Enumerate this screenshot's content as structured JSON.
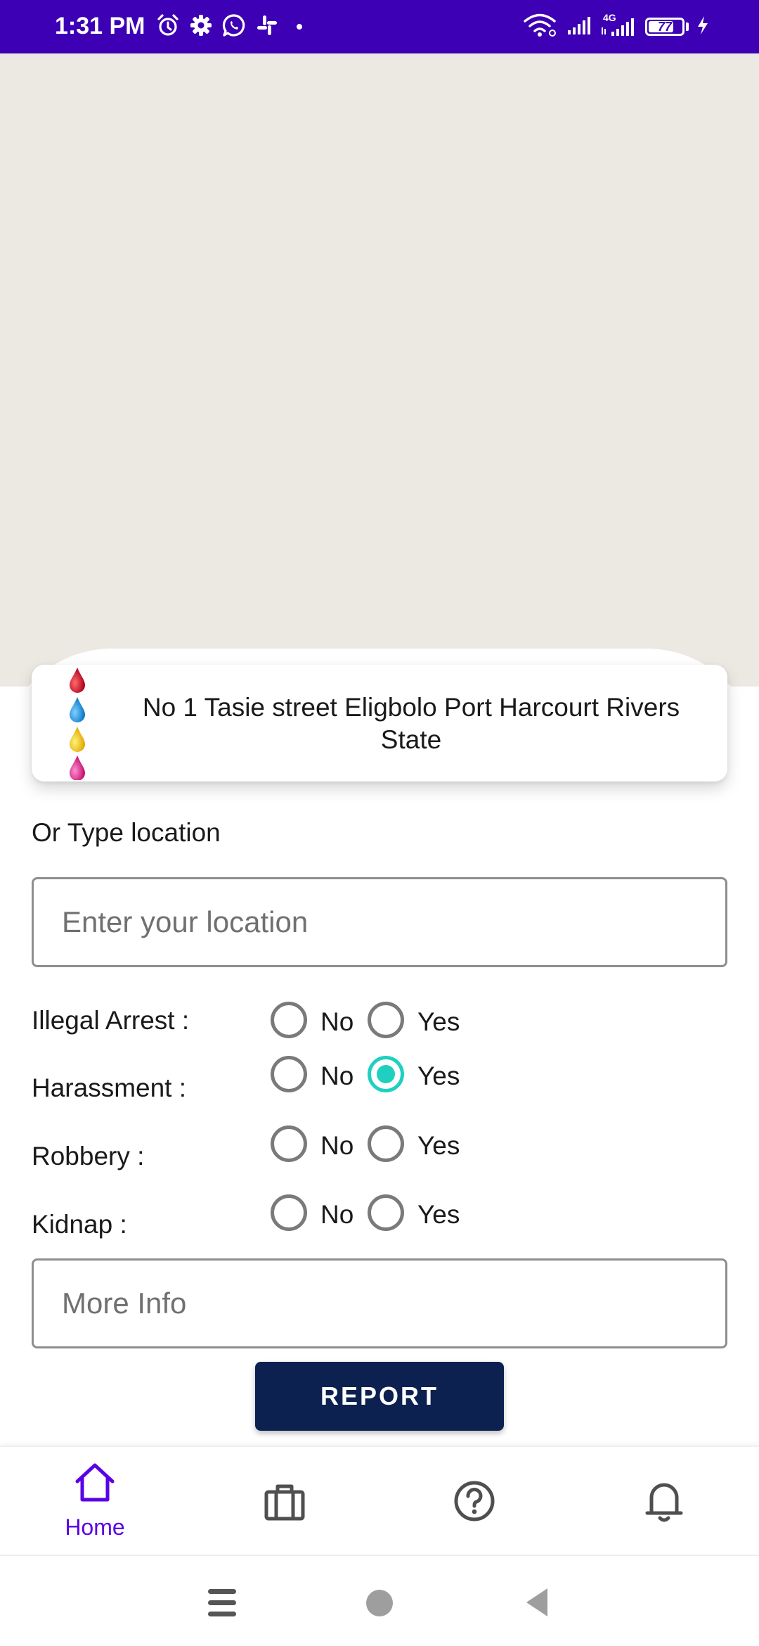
{
  "status_bar": {
    "time": "1:31 PM",
    "network": "4G",
    "battery_percent": "77",
    "battery_level": 0.77,
    "left_icons": [
      "alarm-icon",
      "settings-icon",
      "whatsapp-icon",
      "slack-icon",
      "dot-icon"
    ],
    "right_icons": [
      "wifi-icon",
      "signal-icon",
      "signal-4g-icon",
      "battery-icon",
      "charging-icon"
    ],
    "color": "#3d00b4"
  },
  "map": {
    "background_color": "#ebe9e2"
  },
  "address_card": {
    "address": "No 1 Tasie street Eligbolo Port Harcourt Rivers State",
    "logo_icon": "ink-drops-logo",
    "drop_colors": [
      "#c8102e",
      "#1e9be0",
      "#f4c20d",
      "#e0218a"
    ]
  },
  "form": {
    "type_location_label": "Or Type location",
    "location_placeholder": "Enter your location",
    "questions": [
      {
        "label": "Illegal Arrest :",
        "no_label": "No",
        "yes_label": "Yes",
        "selected": "none"
      },
      {
        "label": "Harassment :",
        "no_label": "No",
        "yes_label": "Yes",
        "selected": "yes"
      },
      {
        "label": "Robbery :",
        "no_label": "No",
        "yes_label": "Yes",
        "selected": "none"
      },
      {
        "label": "Kidnap :",
        "no_label": "No",
        "yes_label": "Yes",
        "selected": "none"
      }
    ],
    "more_info_placeholder": "More Info",
    "report_button": "REPORT",
    "accent_color": "#1fd0c0",
    "button_color": "#0c2150"
  },
  "bottom_nav": {
    "items": [
      {
        "icon": "home-icon",
        "label": "Home",
        "active": true
      },
      {
        "icon": "briefcase-icon",
        "label": "",
        "active": false
      },
      {
        "icon": "help-icon",
        "label": "",
        "active": false
      },
      {
        "icon": "bell-icon",
        "label": "",
        "active": false
      }
    ],
    "active_color": "#5a00e6"
  },
  "system_nav": {
    "icons": [
      "menu-icon",
      "home-circle-icon",
      "back-icon"
    ]
  }
}
